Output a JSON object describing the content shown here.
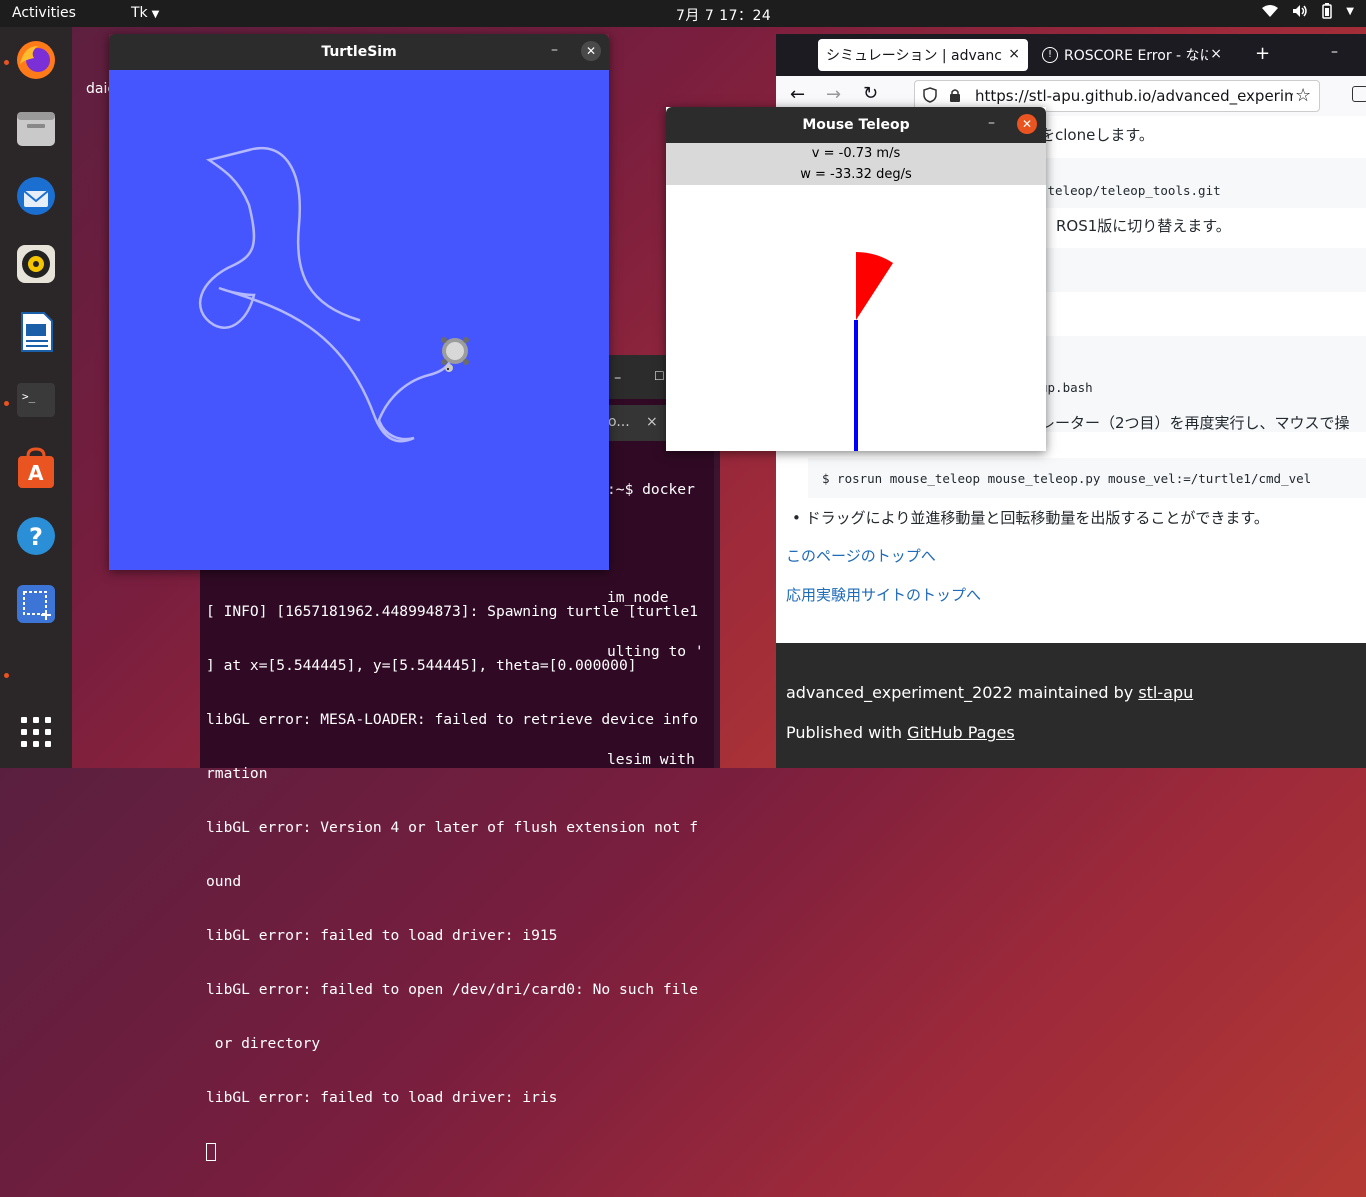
{
  "topbar": {
    "activities": "Activities",
    "app_menu": "Tk",
    "clock": "7月 7 17：24"
  },
  "desktop": {
    "label": "daic"
  },
  "dock": {
    "items": [
      "firefox-icon",
      "files-icon",
      "thunderbird-icon",
      "rhythmbox-icon",
      "libreoffice-writer-icon",
      "terminal-icon",
      "software-center-icon",
      "help-icon",
      "screenshot-icon",
      "show-apps-icon"
    ]
  },
  "turtlesim": {
    "title": "TurtleSim",
    "background": "#4556ff",
    "pen_color": "#b3b8ff"
  },
  "teleop": {
    "title": "Mouse Teleop",
    "v": "v = -0.73 m/s",
    "w": "w = -33.32 deg/s"
  },
  "terminal": {
    "prompt_fragment": ":~$ docker",
    "right_lines": [
      "im_node",
      "ulting to '",
      "",
      "lesim with"
    ],
    "lines": [
      "[ INFO] [1657181962.448994873]: Spawning turtle [turtle1",
      "] at x=[5.544445], y=[5.544445], theta=[0.000000]",
      "libGL error: MESA-LOADER: failed to retrieve device info",
      "rmation",
      "libGL error: Version 4 or later of flush extension not f",
      "ound",
      "libGL error: failed to load driver: i915",
      "libGL error: failed to open /dev/dri/card0: No such file",
      " or directory",
      "libGL error: failed to load driver: iris"
    ],
    "tab_fragment": "o..."
  },
  "browser": {
    "tabs": [
      {
        "label": "シミュレーション | advance",
        "active": true
      },
      {
        "label": "ROSCORE Error - なにか",
        "active": false
      }
    ],
    "new_tab": "+",
    "url": "https://stl-apu.github.io/advanced_experime",
    "content": {
      "text1": "をcloneします。",
      "code1": "-teleop/teleop_tools.git",
      "text2": "ROS1版に切り替えます。",
      "code2": "up.bash",
      "text3": "レーター（2つ目）を再度実行し、マウスで操",
      "command": "$ rosrun mouse_teleop mouse_teleop.py mouse_vel:=/turtle1/cmd_vel",
      "bullet": "ドラッグにより並進移動量と回転移動量を出版することができます。",
      "link_top": "このページのトップへ",
      "link_site": "応用実験用サイトのトップへ"
    },
    "footer": {
      "maintained_prefix": "advanced_experiment_2022 maintained by ",
      "maintainer": "stl-apu",
      "published_prefix": "Published with ",
      "published_link": "GitHub Pages"
    }
  }
}
